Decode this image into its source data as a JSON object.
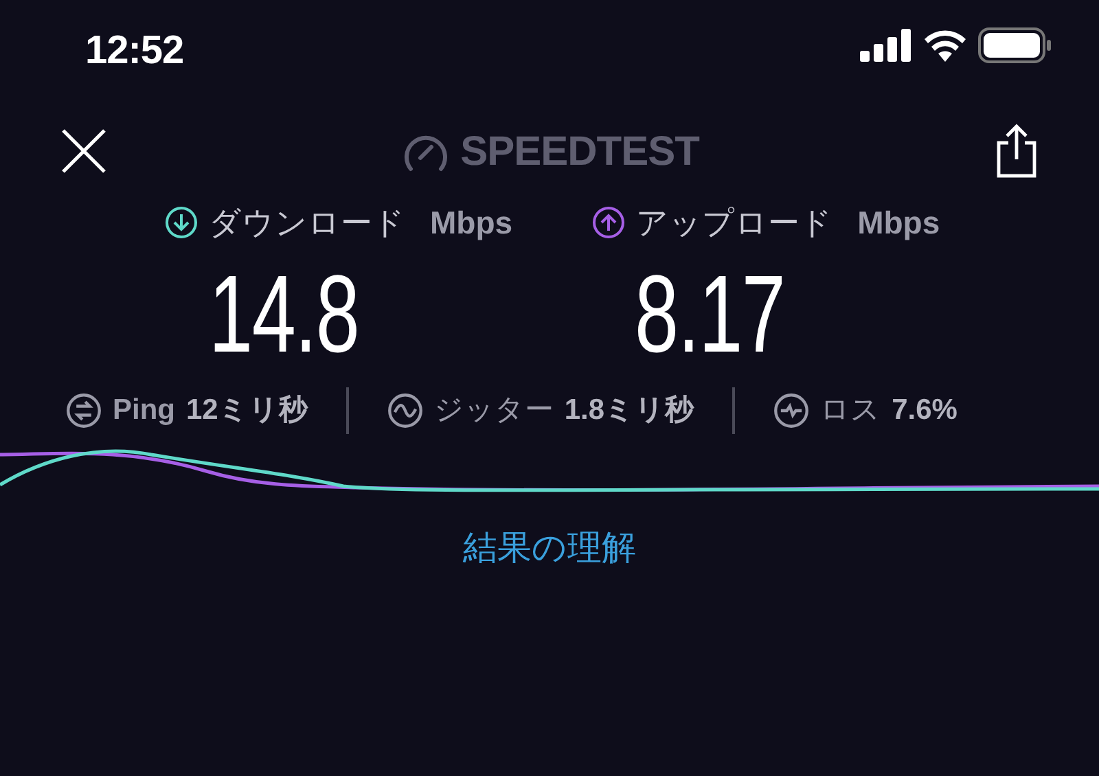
{
  "status_bar": {
    "time": "12:52"
  },
  "header": {
    "title": "SPEEDTEST"
  },
  "results": [
    {
      "kind": "download",
      "label": "ダウンロード",
      "unit": "Mbps",
      "value": "14.8",
      "color": "#5fd9c9"
    },
    {
      "kind": "upload",
      "label": "アップロード",
      "unit": "Mbps",
      "value": "8.17",
      "color": "#a65fe6"
    }
  ],
  "stats": [
    {
      "kind": "ping",
      "label": "Ping",
      "value": "12ミリ秒"
    },
    {
      "kind": "jitter",
      "label": "ジッター",
      "value": "1.8ミリ秒"
    },
    {
      "kind": "loss",
      "label": "ロス",
      "value": "7.6%"
    }
  ],
  "link": "結果の理解"
}
